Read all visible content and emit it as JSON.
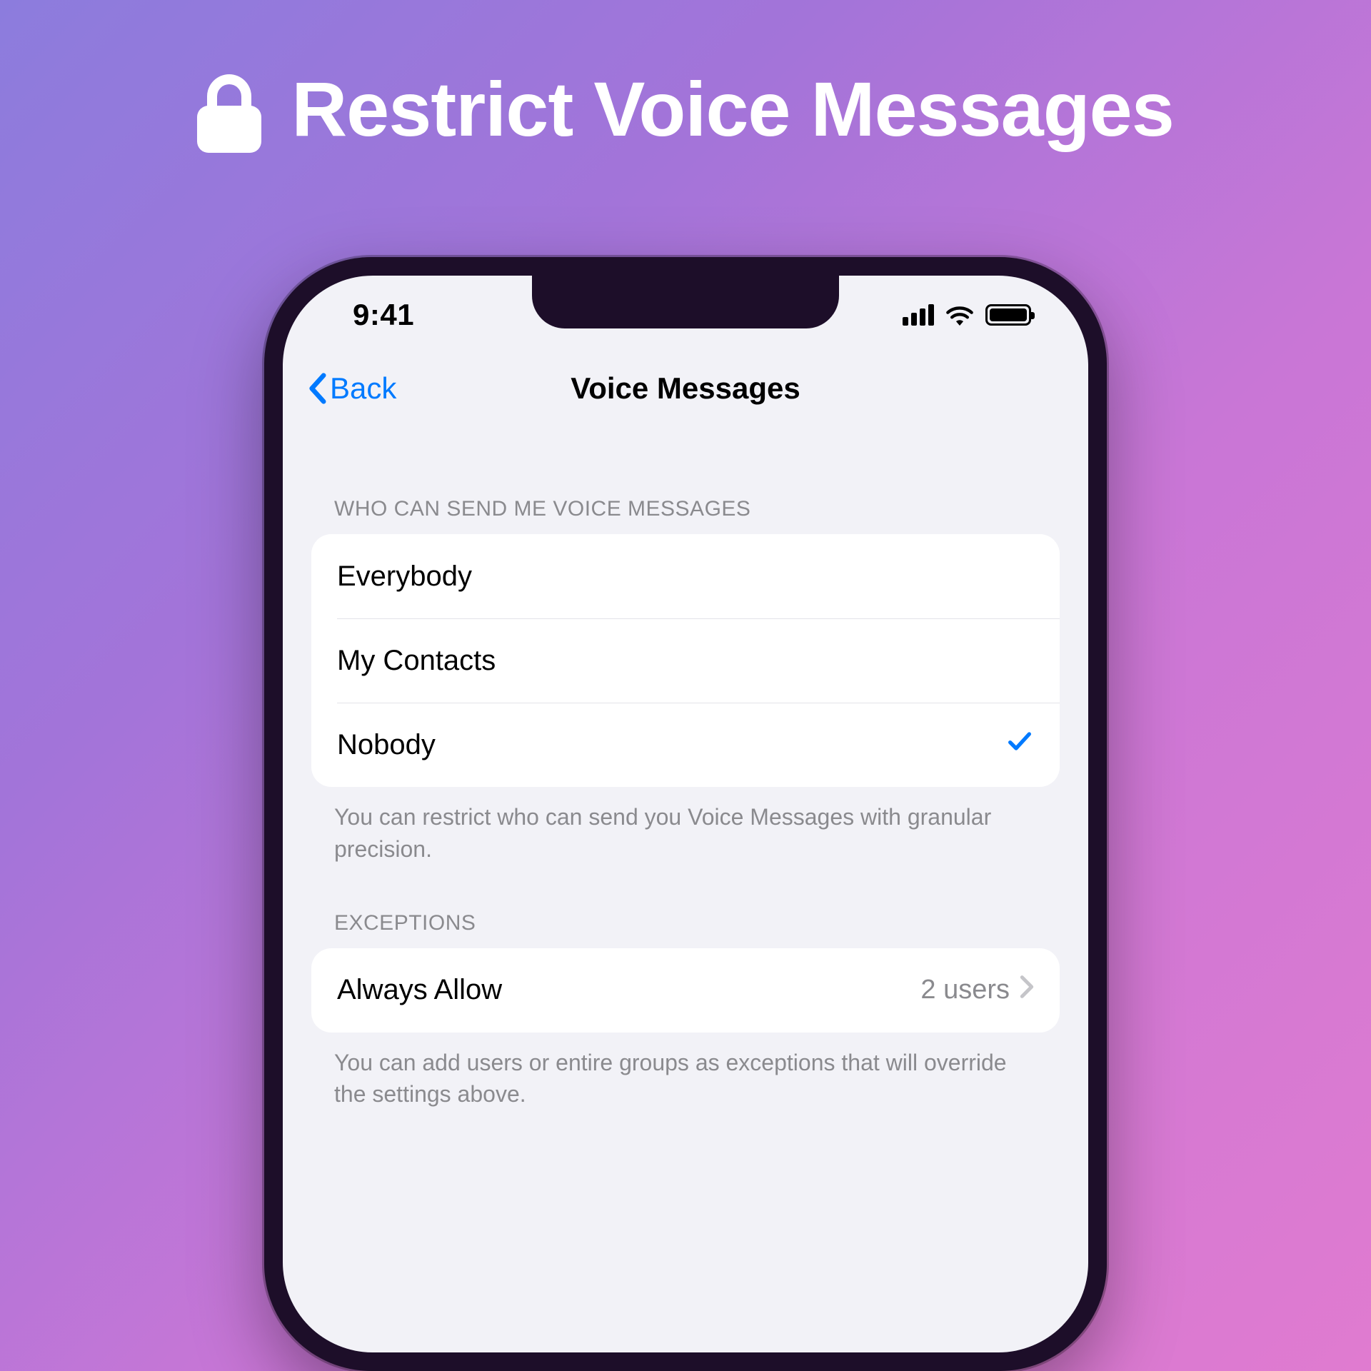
{
  "hero": {
    "title": "Restrict Voice Messages"
  },
  "statusbar": {
    "time": "9:41"
  },
  "navbar": {
    "back_label": "Back",
    "title": "Voice Messages"
  },
  "sections": {
    "who": {
      "header": "WHO CAN SEND ME VOICE MESSAGES",
      "options": [
        {
          "label": "Everybody",
          "selected": false
        },
        {
          "label": "My Contacts",
          "selected": false
        },
        {
          "label": "Nobody",
          "selected": true
        }
      ],
      "footer": "You can restrict who can send you Voice Messages with granular precision."
    },
    "exceptions": {
      "header": "EXCEPTIONS",
      "row": {
        "label": "Always Allow",
        "detail": "2 users"
      },
      "footer": "You can add users or entire groups as exceptions that will override the settings above."
    }
  },
  "colors": {
    "ios_blue": "#007aff",
    "settings_bg": "#f2f2f7",
    "secondary_text": "#8a8a8e"
  }
}
